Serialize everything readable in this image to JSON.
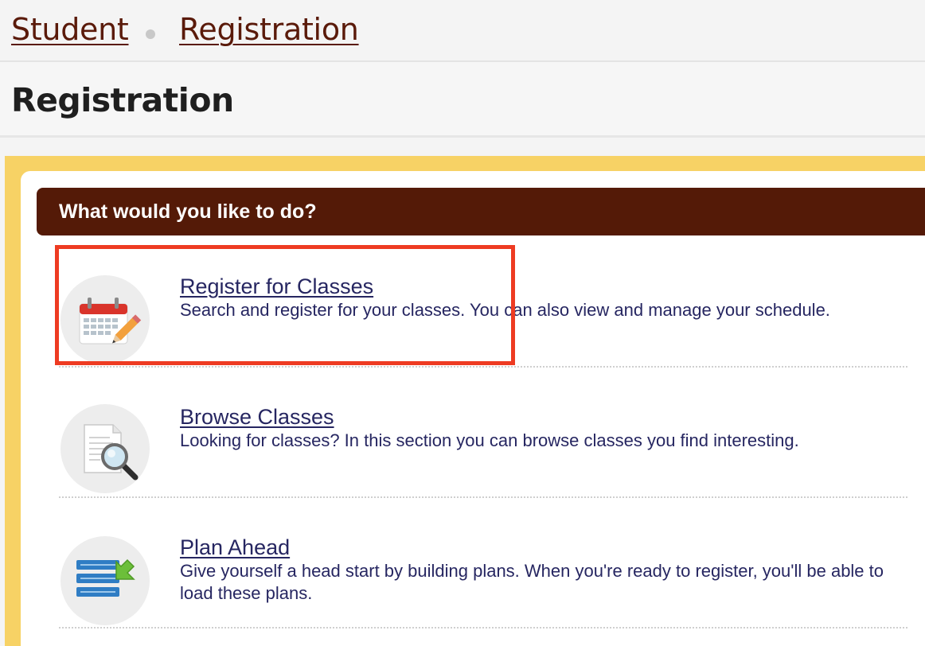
{
  "breadcrumb": {
    "items": [
      "Student",
      "Registration"
    ]
  },
  "page": {
    "title": "Registration"
  },
  "panel": {
    "header": "What would you like to do?",
    "options": [
      {
        "label": "Register for Classes",
        "description": "Search and register for your classes. You can also view and manage your schedule.",
        "icon": "calendar-pencil-icon"
      },
      {
        "label": "Browse Classes",
        "description": "Looking for classes? In this section you can browse classes you find interesting.",
        "icon": "document-magnifier-icon"
      },
      {
        "label": "Plan Ahead",
        "description": "Give yourself a head start by building plans. When you're ready to register, you'll be able to load these plans.",
        "icon": "list-arrow-icon"
      }
    ]
  },
  "colors": {
    "breadcrumb_link": "#5a1a0a",
    "header_bg": "#541a07",
    "frame_yellow": "#f7d265",
    "link_text": "#262661",
    "highlight": "#ee3b22"
  }
}
